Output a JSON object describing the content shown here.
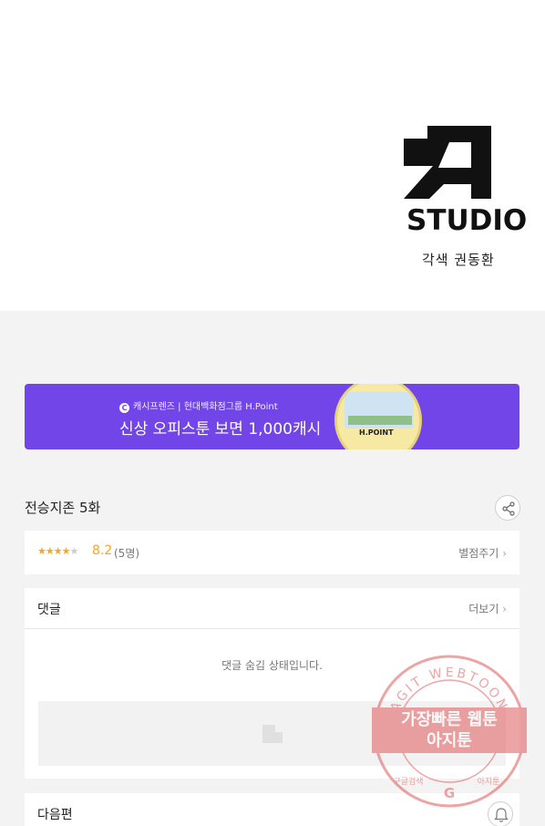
{
  "studio": {
    "logo_letter": "A",
    "name": "STUDIO",
    "credit": "각색 권동환"
  },
  "banner": {
    "sub_text": "캐시프렌즈 | 현대백화점그룹 H.Point",
    "title": "신상 오피스툰 보면 1,000캐시",
    "image_brand": "H.POINT",
    "accent": "#7245e8"
  },
  "episode": {
    "title": "전승지존 5화",
    "share_icon": "share-icon"
  },
  "rating": {
    "stars_filled": 4,
    "stars_total": 5,
    "score": "8.2",
    "count": "(5명)",
    "rate_link": "별점주기",
    "color": "#f5a623"
  },
  "comments": {
    "title": "댓글",
    "more_link": "더보기",
    "hidden_message": "댓글 숨김 상태입니다."
  },
  "next": {
    "title": "다음편",
    "bell_icon": "bell-icon"
  },
  "watermark": {
    "ring_text": "AGIT WEBTOON",
    "main_line1": "가장빠른 웹툰",
    "main_line2": "아지툰",
    "bottom_left": "구글검색",
    "bottom_right": "아지툰",
    "color": "#e05a5a"
  }
}
